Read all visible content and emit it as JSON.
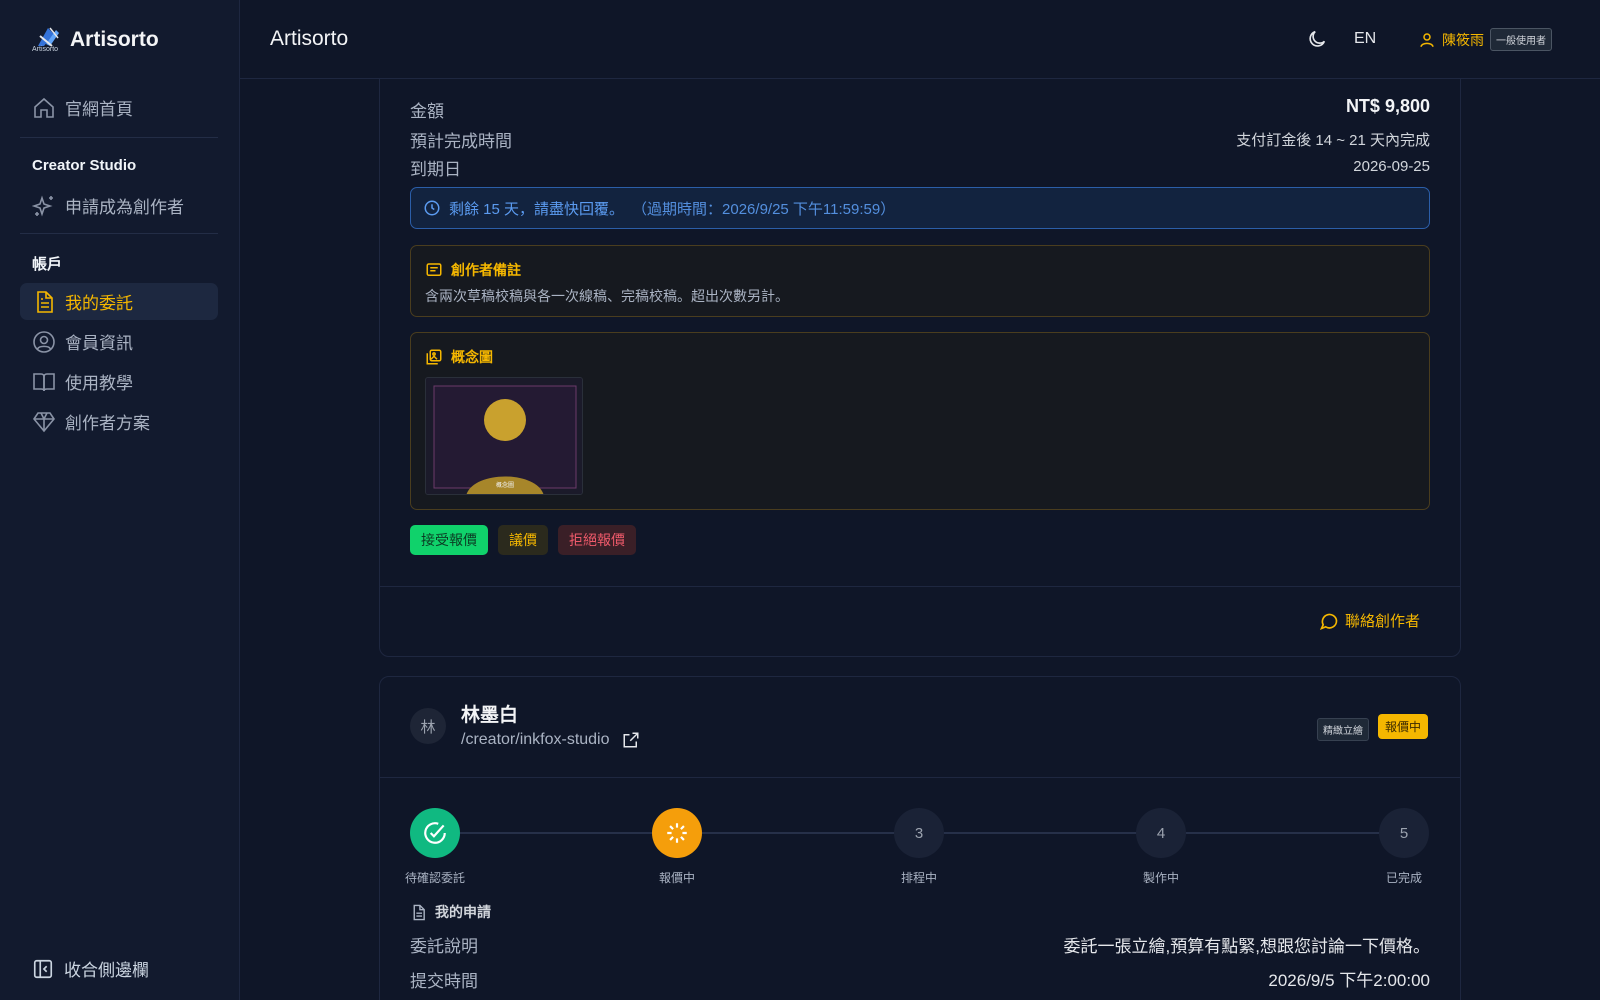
{
  "sidebar": {
    "brand": "Artisorto",
    "brand_sub": "Artisorto",
    "home": "官網首頁",
    "studio_title": "Creator Studio",
    "apply_creator": "申請成為創作者",
    "account_title": "帳戶",
    "my_commissions": "我的委託",
    "member_info": "會員資訊",
    "tutorial": "使用教學",
    "creator_plan": "創作者方案",
    "collapse": "收合側邊欄"
  },
  "header": {
    "title": "Artisorto",
    "lang": "EN",
    "user_name": "陳筱雨",
    "role": "一般使用者"
  },
  "quote": {
    "rows": [
      {
        "label": "金額",
        "value": "NT$ 9,800"
      },
      {
        "label": "預計完成時間",
        "value": "支付訂金後 14 ~ 21 天內完成"
      },
      {
        "label": "到期日",
        "value": "2026-09-25"
      }
    ],
    "deadline_text": "剩餘 15 天，請盡快回覆。",
    "deadline_expiry": "（過期時間：2026/9/25 下午11:59:59）",
    "note_title": "創作者備註",
    "note_text": "含兩次草稿校稿與各一次線稿、完稿校稿。超出次數另計。",
    "concept_title": "概念圖",
    "concept_caption": "概念圖",
    "accept": "接受報價",
    "negotiate": "議價",
    "reject": "拒絕報價",
    "contact": "聯絡創作者"
  },
  "commission2": {
    "avatar_initial": "林",
    "creator_name": "林墨白",
    "creator_path": "/creator/inkfox-studio",
    "type_tag": "精緻立繪",
    "status_tag": "報價中",
    "steps": [
      {
        "num": "",
        "label": "待確認委託"
      },
      {
        "num": "",
        "label": "報價中"
      },
      {
        "num": "3",
        "label": "排程中"
      },
      {
        "num": "4",
        "label": "製作中"
      },
      {
        "num": "5",
        "label": "已完成"
      }
    ],
    "request_title": "我的申請",
    "desc_label": "委託說明",
    "desc_value": "委託一張立繪,預算有點緊,想跟您討論一下價格。",
    "submit_label": "提交時間",
    "submit_value": "2026/9/5 下午2:00:00"
  }
}
